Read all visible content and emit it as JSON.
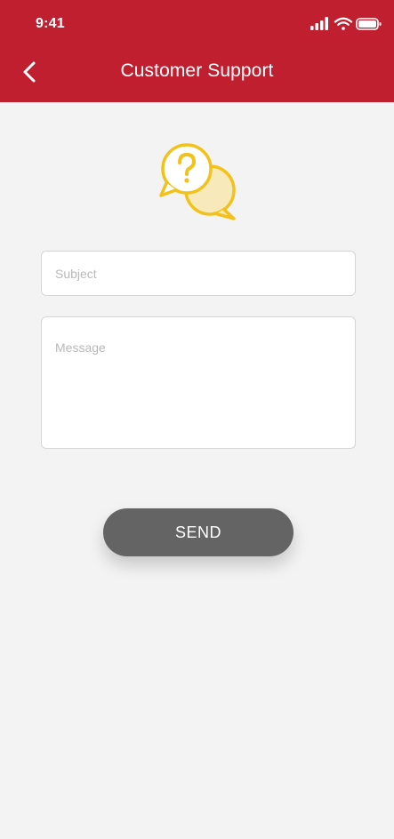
{
  "status_bar": {
    "time": "9:41",
    "icons": [
      "cellular-signal-icon",
      "wifi-icon",
      "battery-icon"
    ]
  },
  "header": {
    "title": "Customer Support",
    "back_icon": "chevron-left-icon",
    "background_color": "#bf1f2f"
  },
  "illustration": {
    "icon": "question-chat-bubbles-icon",
    "color": "#f2c21b"
  },
  "form": {
    "subject_placeholder": "Subject",
    "subject_value": "",
    "message_placeholder": "Message",
    "message_value": "",
    "send_label": "SEND",
    "send_color": "#646464"
  }
}
